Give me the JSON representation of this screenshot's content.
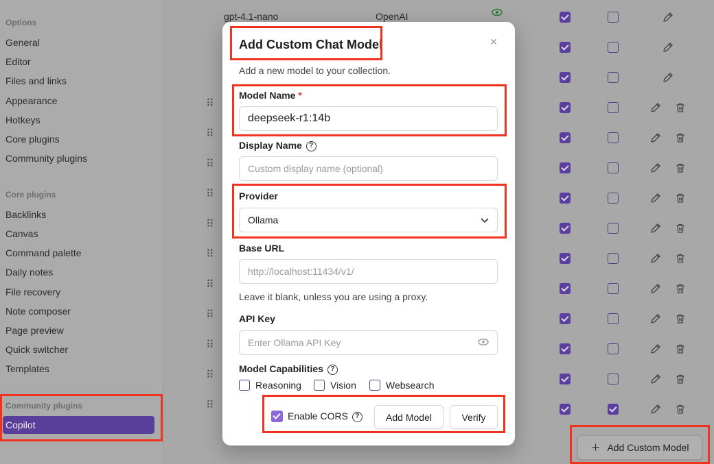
{
  "sidebar": {
    "options_heading": "Options",
    "options_items": [
      "General",
      "Editor",
      "Files and links",
      "Appearance",
      "Hotkeys",
      "Core plugins",
      "Community plugins"
    ],
    "core_heading": "Core plugins",
    "core_items": [
      "Backlinks",
      "Canvas",
      "Command palette",
      "Daily notes",
      "File recovery",
      "Note composer",
      "Page preview",
      "Quick switcher",
      "Templates"
    ],
    "community_heading": "Community plugins",
    "active_item": "Copilot"
  },
  "model_list": {
    "first_row": {
      "model": "gpt-4.1-nano",
      "provider": "OpenAI"
    },
    "add_button_label": "Add Custom Model"
  },
  "modal": {
    "title": "Add Custom Chat Model",
    "subtitle": "Add a new model to your collection.",
    "close_symbol": "×",
    "model_name": {
      "label": "Model Name",
      "required_mark": "*",
      "value": "deepseek-r1:14b"
    },
    "display_name": {
      "label": "Display Name",
      "placeholder": "Custom display name (optional)"
    },
    "provider": {
      "label": "Provider",
      "selected": "Ollama"
    },
    "base_url": {
      "label": "Base URL",
      "placeholder": "http://localhost:11434/v1/",
      "hint": "Leave it blank, unless you are using a proxy."
    },
    "api_key": {
      "label": "API Key",
      "placeholder": "Enter Ollama API Key"
    },
    "capabilities": {
      "label": "Model Capabilities",
      "options": [
        "Reasoning",
        "Vision",
        "Websearch"
      ]
    },
    "enable_cors": {
      "label": "Enable CORS",
      "checked": true
    },
    "add_model_label": "Add Model",
    "verify_label": "Verify"
  },
  "help_symbol": "?",
  "colors": {
    "accent": "#5a3f9a",
    "highlight": "#f0321e",
    "required": "#e0383e"
  }
}
